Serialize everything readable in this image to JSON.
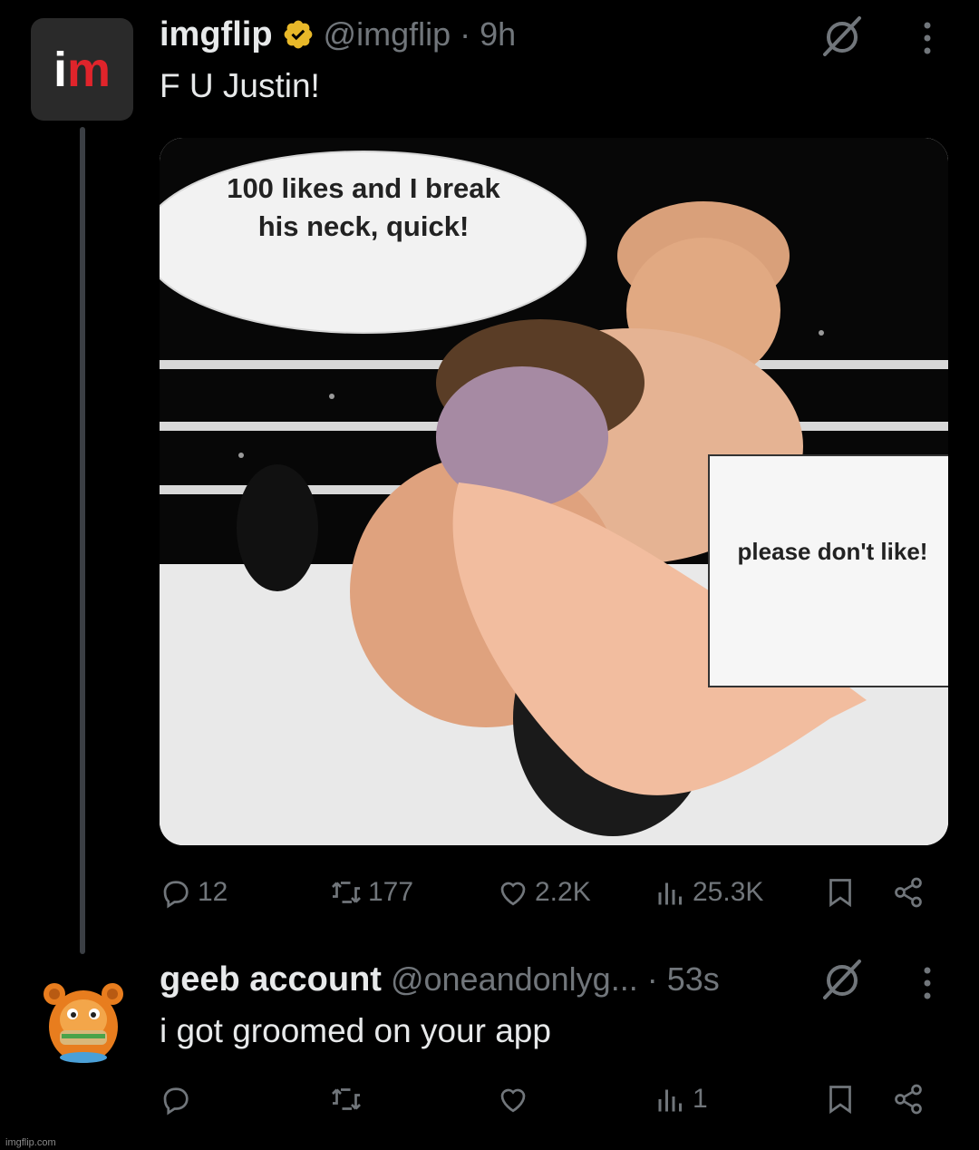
{
  "tweets": [
    {
      "avatar_text_i": "i",
      "avatar_text_m": "m",
      "name": "imgflip",
      "handle": "@imgflip",
      "time": "· 9h",
      "text": "F U Justin!",
      "media": {
        "bubble_left": "100 likes and I break his neck, quick!",
        "bubble_right": "please don't like!"
      },
      "stats": {
        "replies": "12",
        "reposts": "177",
        "likes": "2.2K",
        "views": "25.3K"
      }
    },
    {
      "name": "geeb account",
      "handle": "@oneandonlyg...",
      "time": "· 53s",
      "text": "i got groomed on your app",
      "stats": {
        "replies": "",
        "reposts": "",
        "likes": "",
        "views": "1"
      }
    }
  ],
  "watermark": "imgflip.com",
  "colors": {
    "background": "#000000",
    "text": "#e7e9ea",
    "muted": "#71767b",
    "verified": "#e8b829",
    "brand_red": "#e0242b"
  }
}
